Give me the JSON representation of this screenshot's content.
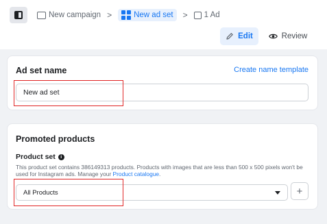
{
  "breadcrumb": {
    "campaign": "New campaign",
    "ad_set": "New ad set",
    "ad": "1 Ad",
    "separator": ">"
  },
  "mode": {
    "edit_label": "Edit",
    "review_label": "Review"
  },
  "ad_set_name": {
    "title": "Ad set name",
    "create_template_link": "Create name template",
    "value": "New ad set"
  },
  "promoted_products": {
    "title": "Promoted products",
    "product_set_label": "Product set",
    "help_text": "This product set contains 386149313 products. Products with images that are less than 500 x 500 pixels won't be used for Instagram ads. Manage your",
    "help_link": "Product catalogue",
    "help_end": ".",
    "selected_option": "All Products",
    "add_label": "+"
  },
  "colors": {
    "accent": "#1877f2",
    "highlight": "#e02424",
    "background": "#f0f2f5"
  },
  "icons": {
    "sidebar_toggle": "sidebar-toggle-icon",
    "campaign": "folder-outline-icon",
    "ad_set": "grid-icon",
    "ad": "square-outline-icon",
    "edit": "pencil-icon",
    "review": "eye-icon",
    "info": "info-icon",
    "dropdown": "caret-down-icon"
  }
}
